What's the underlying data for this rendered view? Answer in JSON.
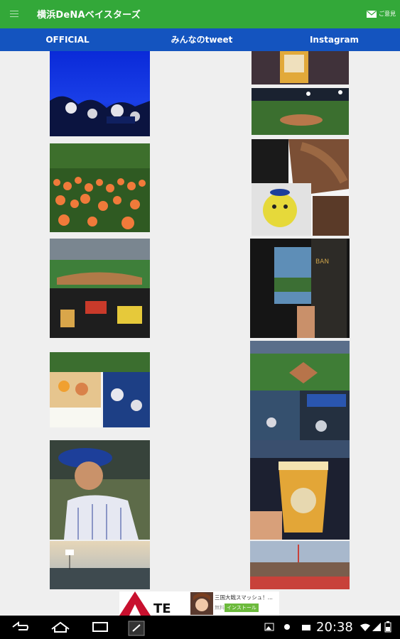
{
  "app": {
    "title": "横浜DeNAベイスターズ",
    "contact_label": "ご意見"
  },
  "tabs": [
    {
      "label": "OFFICIAL"
    },
    {
      "label": "みんなのtweet"
    },
    {
      "label": "Instagram"
    }
  ],
  "ad": {
    "title": "三国大戦スマッシュ！...",
    "free_label": "無料",
    "install_label": "インストール"
  },
  "status": {
    "time": "20:38"
  },
  "colors": {
    "appbar": "#33a839",
    "tabbar": "#1454bf",
    "background": "#efefef"
  }
}
